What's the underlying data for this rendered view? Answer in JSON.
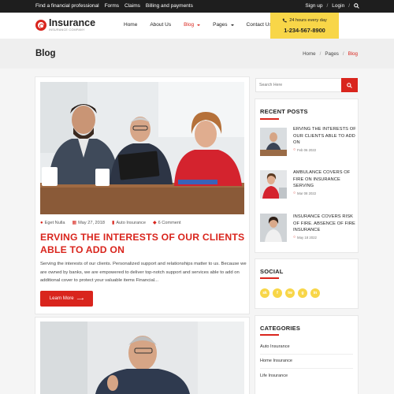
{
  "topbar": {
    "links": [
      "Find a financial professional",
      "Forms",
      "Claims",
      "Billing and payments"
    ],
    "signup": "Sign up",
    "sep": "/",
    "login": "Login"
  },
  "header": {
    "logo_name": "Insurance",
    "logo_tag": "INSURANCE COMPANY",
    "nav": [
      "Home",
      "About Us",
      "Blog",
      "Pages",
      "Contact Us"
    ],
    "active_nav": "Blog",
    "call_hours": "24 hours every day",
    "call_phone": "1-234-567-8900"
  },
  "pagehead": {
    "title": "Blog",
    "breadcrumb": [
      "Home",
      "Pages",
      "Blog"
    ],
    "sep": "/"
  },
  "post": {
    "author": "Eget Nulla",
    "date": "May 27, 2018",
    "category": "Auto Insurance",
    "comments": "6 Comment",
    "title": "ERVING THE INTERESTS OF OUR CLIENTS ABLE TO ADD ON",
    "excerpt": "Serving the interests of our clients. Personalized support and relationships matter to us. Because we are owned by banks, we are empowered to deliver top-notch support and services able to add on additional cover to protect your valuable items Financial...",
    "read_more": "Learn More"
  },
  "sidebar": {
    "search_placeholder": "Search Here",
    "recent_title": "RECENT POSTS",
    "recent": [
      {
        "title": "ERVING THE INTERESTS OF OUR CLIENTS ABLE TO ADD ON",
        "date": "Feb 06 2022"
      },
      {
        "title": "AMBULANCE COVERS OF FIRE ON INSURANCE SERVING",
        "date": "Mar 08 2022"
      },
      {
        "title": "INSURANCE COVERS RISK OF FIRE. ABSENCE OF FIRE INSURANCE",
        "date": "May 18 2022"
      }
    ],
    "social_title": "SOCIAL",
    "social": [
      "sk",
      "f",
      "tw",
      "g",
      "in"
    ],
    "categories_title": "CATEGORIES",
    "categories": [
      "Auto Insurance",
      "Home Insurance",
      "Life Insurance"
    ]
  },
  "colors": {
    "accent": "#d9251d",
    "yellow": "#f8d648",
    "dark": "#1e1e1e"
  }
}
